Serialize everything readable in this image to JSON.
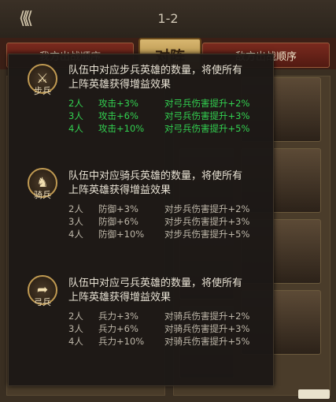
{
  "header": {
    "level": "1-2",
    "tab_left": "我方出战顺序",
    "tab_center": "对阵",
    "tab_right": "敌方出战顺序"
  },
  "sections": [
    {
      "badge_label": "步兵",
      "icon": "sword-icon",
      "desc_line1": "队伍中对应步兵英雄的数量，将使所有",
      "desc_line2": "上阵英雄获得增益效果",
      "active": true,
      "rows": [
        {
          "count": "2人",
          "stat": "攻击+3%",
          "effect": "对弓兵伤害提升+2%"
        },
        {
          "count": "3人",
          "stat": "攻击+6%",
          "effect": "对弓兵伤害提升+3%"
        },
        {
          "count": "4人",
          "stat": "攻击+10%",
          "effect": "对弓兵伤害提升+5%"
        }
      ]
    },
    {
      "badge_label": "骑兵",
      "icon": "horse-icon",
      "desc_line1": "队伍中对应骑兵英雄的数量，将使所有",
      "desc_line2": "上阵英雄获得增益效果",
      "active": false,
      "rows": [
        {
          "count": "2人",
          "stat": "防御+3%",
          "effect": "对步兵伤害提升+2%"
        },
        {
          "count": "3人",
          "stat": "防御+6%",
          "effect": "对步兵伤害提升+3%"
        },
        {
          "count": "4人",
          "stat": "防御+10%",
          "effect": "对步兵伤害提升+5%"
        }
      ]
    },
    {
      "badge_label": "弓兵",
      "icon": "bow-icon",
      "desc_line1": "队伍中对应弓兵英雄的数量，将使所有",
      "desc_line2": "上阵英雄获得增益效果",
      "active": false,
      "rows": [
        {
          "count": "2人",
          "stat": "兵力+3%",
          "effect": "对骑兵伤害提升+2%"
        },
        {
          "count": "3人",
          "stat": "兵力+6%",
          "effect": "对骑兵伤害提升+3%"
        },
        {
          "count": "4人",
          "stat": "兵力+10%",
          "effect": "对骑兵伤害提升+5%"
        }
      ]
    }
  ],
  "colors": {
    "active_green": "#32d050",
    "inactive_grey": "#bdb6a8",
    "tab_red": "#7a2a1e",
    "tab_gold": "#d8b770"
  }
}
